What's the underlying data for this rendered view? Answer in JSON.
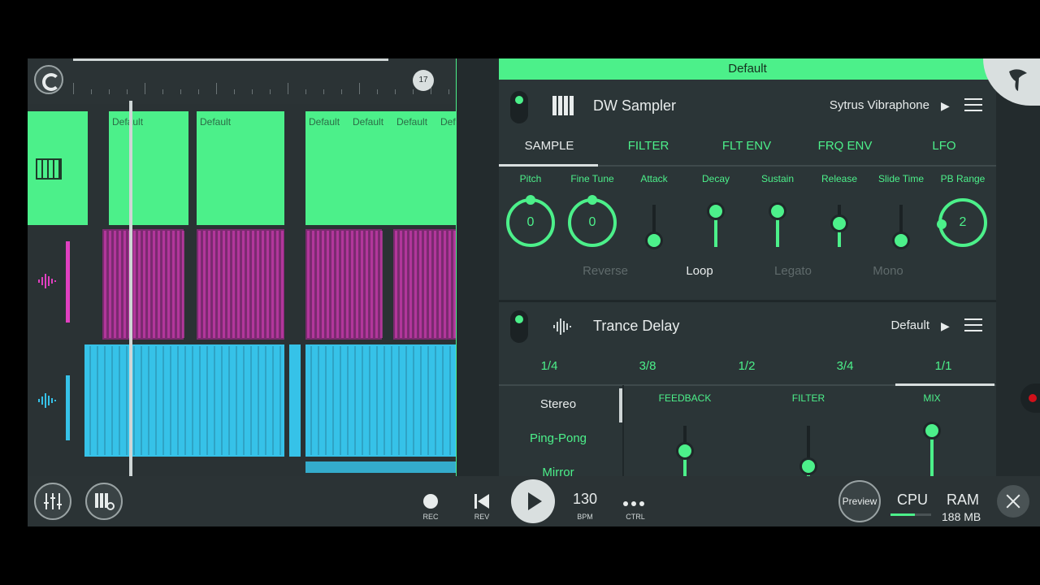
{
  "playlist": {
    "bar_number": "17",
    "clip_name": "Default",
    "lane1_clips": [
      "Default",
      "Default",
      "Default",
      "Default",
      "Default",
      "Def"
    ]
  },
  "header": {
    "preset_bar": "Default"
  },
  "sampler": {
    "title": "DW Sampler",
    "preset": "Sytrus Vibraphone",
    "tabs": [
      "SAMPLE",
      "FILTER",
      "FLT ENV",
      "FRQ ENV",
      "LFO"
    ],
    "active_tab": "SAMPLE",
    "knobs": [
      {
        "label": "Pitch",
        "value": "0"
      },
      {
        "label": "Fine Tune",
        "value": "0"
      },
      {
        "label": "PB Range",
        "value": "2"
      }
    ],
    "sliders": [
      {
        "label": "Attack",
        "level": 0.15
      },
      {
        "label": "Decay",
        "level": 0.85
      },
      {
        "label": "Sustain",
        "level": 0.85
      },
      {
        "label": "Release",
        "level": 0.55
      },
      {
        "label": "Slide Time",
        "level": 0.15
      }
    ],
    "options": [
      "Reverse",
      "Loop",
      "Legato",
      "Mono"
    ],
    "active_option": "Loop"
  },
  "delay": {
    "title": "Trance Delay",
    "preset": "Default",
    "times": [
      "1/4",
      "3/8",
      "1/2",
      "3/4",
      "1/1"
    ],
    "active_time": "1/1",
    "modes": [
      "Stereo",
      "Ping-Pong",
      "Mirror"
    ],
    "active_mode": "Stereo",
    "sliders": [
      {
        "label": "FEEDBACK",
        "level": 0.5
      },
      {
        "label": "FILTER",
        "level": 0.2
      },
      {
        "label": "MIX",
        "level": 0.9
      }
    ]
  },
  "transport": {
    "rec_label": "REC",
    "rev_label": "REV",
    "bpm_value": "130",
    "bpm_label": "BPM",
    "ctrl_label": "CTRL",
    "preview_label": "Preview",
    "cpu_label": "CPU",
    "ram_label": "RAM",
    "ram_value": "188 MB"
  },
  "colors": {
    "accent": "#4cf08a",
    "pattern": "#7b2a70",
    "audio": "#36c2e8",
    "bg": "#232b2d"
  }
}
